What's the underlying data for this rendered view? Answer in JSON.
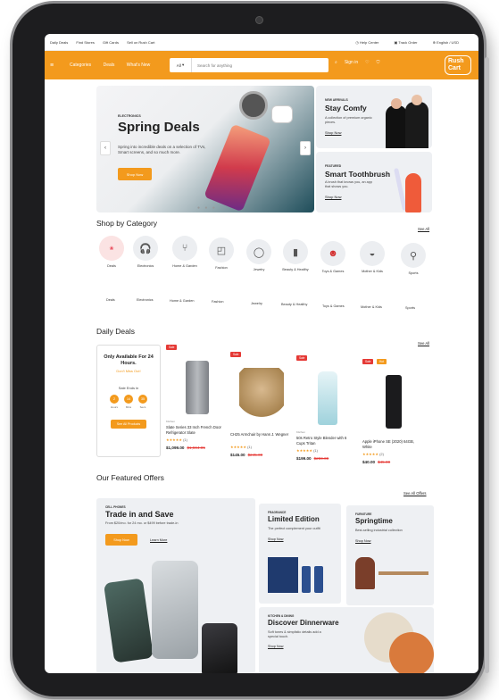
{
  "topbar": {
    "links": [
      "Daily Deals",
      "Find Stores",
      "Gift Cards",
      "Sell on Rush Cart"
    ],
    "help": "Help Center",
    "track": "Track Order",
    "locale": "English / USD"
  },
  "header": {
    "nav": [
      "Categories",
      "Deals",
      "What's New"
    ],
    "search_scope": "All",
    "search_placeholder": "Search for anything",
    "signin": "Sign in",
    "logo_line1": "Rush",
    "logo_line2": "Cart"
  },
  "hero": {
    "tag": "ELECTRONICS",
    "title": "Spring Deals",
    "text": "Spring into incredible deals on a selection of TVs, Smart screens, and so much more.",
    "button": "Shop Now",
    "dots": "● ● ●"
  },
  "promos": [
    {
      "tag": "NEW ARRIVALS",
      "title": "Stay Comfy",
      "text": "A collection of premium organic pieces.",
      "link": "Shop Now"
    },
    {
      "tag": "FEATURED",
      "title": "Smart Toothbrush",
      "text": "A brush that knows you, an app that shows you.",
      "link": "Shop Now"
    }
  ],
  "categories": {
    "title": "Shop by Category",
    "see_all": "See All",
    "items": [
      {
        "label": "Deals",
        "icon": "deals-icon"
      },
      {
        "label": "Electronics",
        "icon": "headphones-icon"
      },
      {
        "label": "Home & Garden",
        "icon": "chair-icon"
      },
      {
        "label": "Fashion",
        "icon": "bag-icon"
      },
      {
        "label": "Jewelry",
        "icon": "ring-icon"
      },
      {
        "label": "Beauty & Healthy",
        "icon": "lipstick-icon"
      },
      {
        "label": "Toys & Games",
        "icon": "mario-icon"
      },
      {
        "label": "Mother & Kids",
        "icon": "shoes-icon"
      },
      {
        "label": "Sports",
        "icon": "bicycle-icon"
      }
    ]
  },
  "daily_deals": {
    "title": "Daily Deals",
    "see_all": "See All",
    "countdown": {
      "title": "Only Available For 24 Hours.",
      "subtitle": "Don't Miss Out!",
      "ends": "Sale Ends in",
      "values": [
        "2",
        "14",
        "35"
      ],
      "labels": [
        "Hours",
        "Mins",
        "Secs"
      ],
      "button": "See All Products"
    },
    "products": [
      {
        "badge": "Sale",
        "brand": "Kitchen",
        "name": "Slate Series 33 Inch French Door Refrigerator Slate",
        "rating": "★★★★★",
        "reviews": "(1)",
        "price": "$1,099.00",
        "old_price": "$1,594.05",
        "color": "#8d8f93"
      },
      {
        "badge": "Sale",
        "brand": "",
        "name": "CH25 Armchair by Hans J. Wegner",
        "rating": "★★★★★",
        "reviews": "(1)",
        "price": "$145.00",
        "old_price": "$245.00",
        "color": "#c9a77c"
      },
      {
        "badge": "Sale",
        "brand": "Kitchen",
        "name": "50s Retro Style Blender with 6 Cups Tritan",
        "rating": "★★★★★",
        "reviews": "(1)",
        "price": "$199.00",
        "old_price": "$259.00",
        "color": "#bfe3ea"
      },
      {
        "badge": "Sale",
        "badge2": "Hot",
        "brand": "",
        "name": "Apple iPhone SE (2020) 64GB, White",
        "rating": "★★★★★",
        "reviews": "(2)",
        "price": "$40.00",
        "old_price": "$45.00",
        "color": "#1b1b1d"
      }
    ]
  },
  "featured": {
    "title": "Our Featured Offers",
    "see_all": "See All Offers",
    "offers": [
      {
        "tag": "CELL PHONES",
        "title": "Trade in and Save",
        "text": "From $20/mo. for 24 mo. or $499 before trade-in",
        "button": "Shop Now",
        "link": "Learn More"
      },
      {
        "tag": "FRAGRANCE",
        "title": "Limited Edition",
        "text": "The perfect complement your outfit",
        "link": "Shop Now"
      },
      {
        "tag": "FURNITURE",
        "title": "Springtime",
        "text": "Best-selling industrial collection",
        "link": "Shop Now"
      },
      {
        "tag": "KITCHEN & DINING",
        "title": "Discover Dinnerware",
        "text": "Soft tones & simplistic details add a special touch.",
        "link": "Shop Now"
      }
    ]
  }
}
